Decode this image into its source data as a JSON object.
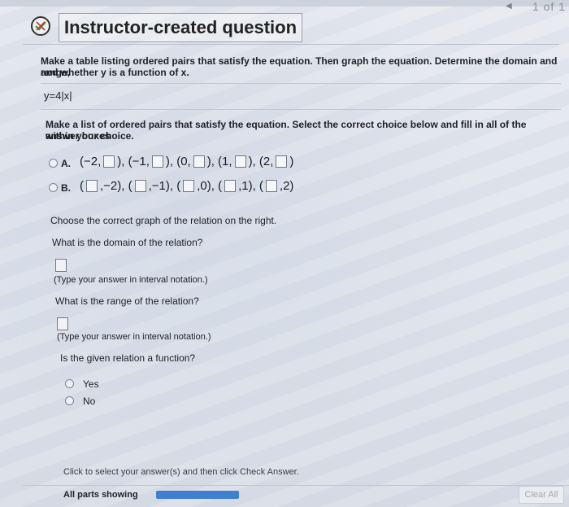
{
  "header": {
    "counter": "1 of 1",
    "title": "Instructor-created question"
  },
  "question": {
    "prompt_line1": "Make a table listing ordered pairs that satisfy the equation. Then graph the equation. Determine the domain and range,",
    "prompt_line2": "and whether y is a function of x.",
    "equation": "y=4|x|"
  },
  "part1": {
    "instruction_line1": "Make a list of ordered pairs that satisfy the equation. Select the correct choice below and fill in all of the answer boxes",
    "instruction_line2": "within your choice.",
    "option_a": {
      "label": "A.",
      "pairs": [
        "(−2,",
        "), (−1,",
        "), (0,",
        "), (1,",
        "), (2,",
        ")"
      ]
    },
    "option_b": {
      "label": "B.",
      "pairs": [
        "(",
        ",−2), (",
        ",−1), (",
        ",0), (",
        ",1), (",
        ",2)"
      ]
    }
  },
  "part2": {
    "graph_instruction": "Choose the correct graph of the relation on the right."
  },
  "domain": {
    "question": "What is the domain of the relation?",
    "hint": "(Type your answer in interval notation.)"
  },
  "range": {
    "question": "What is the range of the relation?",
    "hint": "(Type your answer in interval notation.)"
  },
  "function_q": {
    "question": "Is the given relation a function?",
    "options": [
      "Yes",
      "No"
    ]
  },
  "footer": {
    "instruction": "Click to select your answer(s) and then click Check Answer.",
    "parts_label": "All parts showing",
    "clear_label": "Clear All"
  }
}
